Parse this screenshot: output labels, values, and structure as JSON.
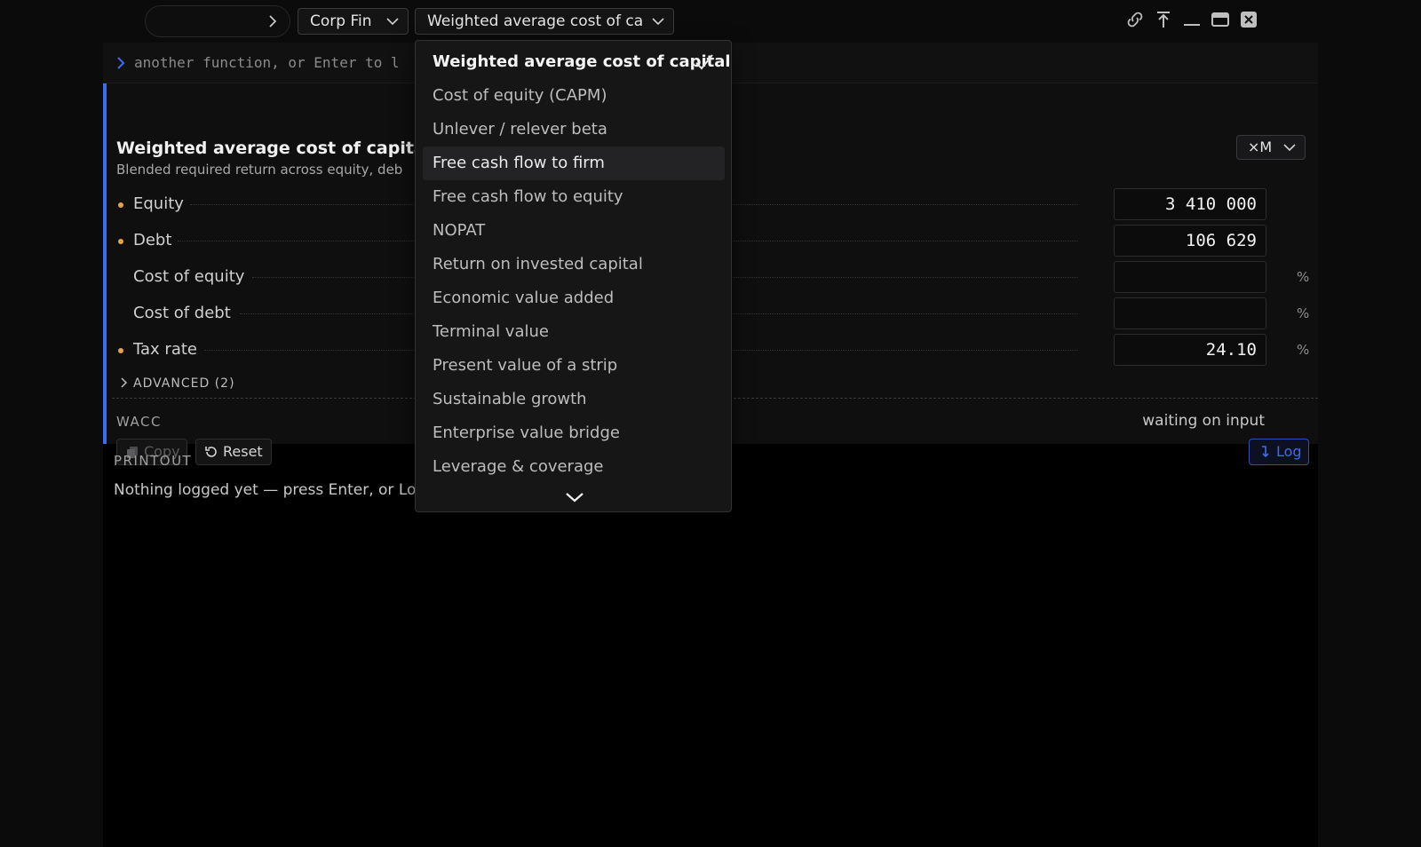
{
  "topbar": {
    "category": "Corp Fin",
    "function": "Weighted average cost of capital"
  },
  "command": {
    "placeholder_text": "another function, or Enter to l"
  },
  "card": {
    "title": "Weighted average cost of capital",
    "subtitle": "Blended required return across equity, deb",
    "unit_selector": "×M",
    "inputs": [
      {
        "label": "Equity",
        "value": "3 410 000",
        "unit": "",
        "required": true
      },
      {
        "label": "Debt",
        "value": "106 629",
        "unit": "",
        "required": true
      },
      {
        "label": "Cost of equity",
        "value": "",
        "unit": "%",
        "required": false
      },
      {
        "label": "Cost of debt",
        "value": "",
        "unit": "%",
        "required": false
      },
      {
        "label": "Tax rate",
        "value": "24.10",
        "unit": "%",
        "required": true
      }
    ],
    "advanced_label": "ADVANCED (2)",
    "result_label": "WACC",
    "status": "waiting on input",
    "buttons": {
      "copy": "Copy",
      "reset": "Reset",
      "log": "Log"
    }
  },
  "printout": {
    "label": "PRINTOUT",
    "message": "Nothing logged yet — press Enter, or Lo"
  },
  "dropdown": {
    "items": [
      "Weighted average cost of capital",
      "Cost of equity (CAPM)",
      "Unlever / relever beta",
      "Free cash flow to firm",
      "Free cash flow to equity",
      "NOPAT",
      "Return on invested capital",
      "Economic value added",
      "Terminal value",
      "Present value of a strip",
      "Sustainable growth",
      "Enterprise value bridge",
      "Leverage & coverage"
    ],
    "selected_index": 0,
    "hover_index": 3
  },
  "colors": {
    "accent": "#3b6df0",
    "required_dot": "#e8a24a",
    "background": "#000000"
  },
  "icons": [
    "chevron-right-icon",
    "chevron-down-icon",
    "link-icon",
    "pin-icon",
    "minimize-icon",
    "maximize-icon",
    "close-icon",
    "copy-icon",
    "reset-icon",
    "log-icon",
    "check-icon"
  ]
}
